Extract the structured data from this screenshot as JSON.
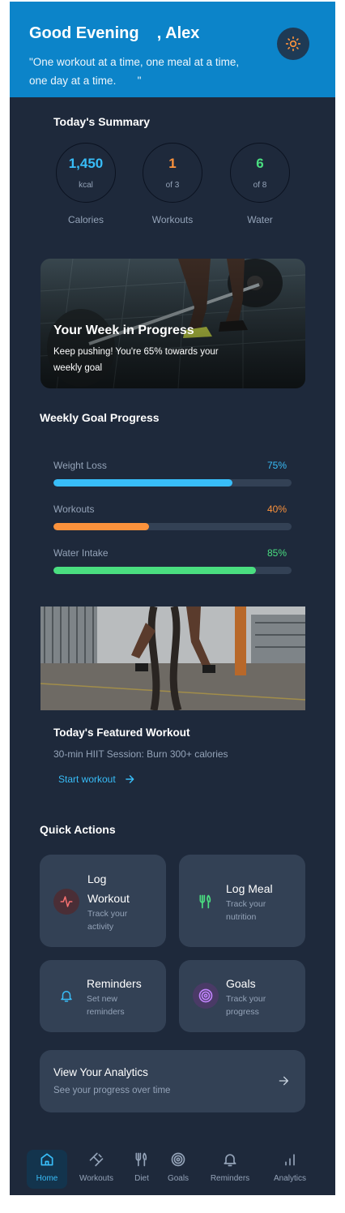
{
  "header": {
    "greeting": "Good Evening    , Alex",
    "quote": "\"One workout at a time, one meal at a time, one day at a time.       \"",
    "theme_toggle_icon": "sun-icon"
  },
  "summary": {
    "title": "Today's Summary",
    "stats": [
      {
        "value": "1,450",
        "sub": "kcal",
        "label": "Calories",
        "color": "#38bdf8"
      },
      {
        "value": "1",
        "sub": "of 3",
        "label": "Workouts",
        "color": "#fb923c"
      },
      {
        "value": "6",
        "sub": "of 8",
        "label": "Water",
        "color": "#4ade80"
      }
    ]
  },
  "hero": {
    "title": "Your Week in Progress",
    "subtitle": "Keep pushing! You're 65% towards your weekly goal"
  },
  "weekly_goals": {
    "title": "Weekly Goal Progress",
    "items": [
      {
        "label": "Weight Loss",
        "percent_text": "75%",
        "progress": 0.75,
        "color": "#38bdf8"
      },
      {
        "label": "Workouts",
        "percent_text": "40%",
        "progress": 0.4,
        "color": "#fb923c"
      },
      {
        "label": "Water Intake",
        "percent_text": "85%",
        "progress": 0.85,
        "color": "#4ade80"
      }
    ]
  },
  "featured": {
    "title": "Today's Featured Workout",
    "subtitle": "30-min HIIT Session: Burn 300+ calories",
    "link": "Start workout"
  },
  "quick_actions": {
    "title": "Quick Actions",
    "items": [
      {
        "title": "Log Workout",
        "sub": "Track your activity",
        "icon": "activity-icon",
        "color": "#f87171"
      },
      {
        "title": "Log Meal",
        "sub": "Track your nutrition",
        "icon": "utensils-icon",
        "color": "#4ade80"
      },
      {
        "title": "Reminders",
        "sub": "Set new reminders",
        "icon": "bell-icon",
        "color": "#38bdf8"
      },
      {
        "title": "Goals",
        "sub": "Track your progress",
        "icon": "target-icon",
        "color": "#c084fc"
      }
    ]
  },
  "analytics": {
    "title": "View Your Analytics",
    "subtitle": "See your progress over time"
  },
  "nav": {
    "items": [
      {
        "label": "Home",
        "icon": "home-icon",
        "active": true
      },
      {
        "label": "Workouts",
        "icon": "dumbbell-icon"
      },
      {
        "label": "Diet",
        "icon": "utensils-icon"
      },
      {
        "label": "Goals",
        "icon": "target-icon"
      },
      {
        "label": "Reminders",
        "icon": "bell-icon"
      },
      {
        "label": "Analytics",
        "icon": "chart-icon"
      }
    ],
    "active_color": "#38bdf8"
  }
}
